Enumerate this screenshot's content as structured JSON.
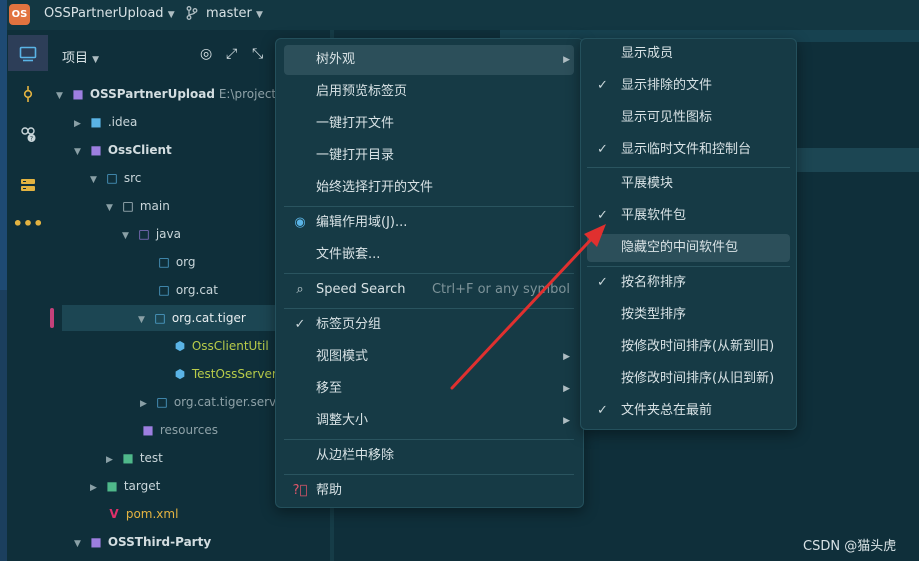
{
  "titlebar": {
    "logo_text": "OS",
    "project": "OSSPartnerUpload",
    "branch": "master"
  },
  "panel": {
    "title": "项目"
  },
  "tree": [
    {
      "label": "OSSPartnerUpload",
      "path": "E:\\project\\(",
      "icon": "module-folder-icon"
    },
    {
      "label": ".idea",
      "icon": "folder-icon"
    },
    {
      "label": "OssClient",
      "icon": "module-folder-icon"
    },
    {
      "label": "src",
      "icon": "source-folder-icon"
    },
    {
      "label": "main",
      "icon": "folder-icon"
    },
    {
      "label": "java",
      "icon": "java-source-folder-icon"
    },
    {
      "label": "org",
      "icon": "package-icon"
    },
    {
      "label": "org.cat",
      "icon": "package-icon"
    },
    {
      "label": "org.cat.tiger",
      "icon": "package-icon"
    },
    {
      "label": "OssClientUtil",
      "icon": "class-icon"
    },
    {
      "label": "TestOssServerU",
      "icon": "class-icon"
    },
    {
      "label": "org.cat.tiger.servic",
      "icon": "package-icon"
    },
    {
      "label": "resources",
      "icon": "resources-folder-icon"
    },
    {
      "label": "test",
      "icon": "test-folder-icon"
    },
    {
      "label": "target",
      "icon": "folder-icon"
    },
    {
      "label": "pom.xml",
      "icon": "maven-icon"
    },
    {
      "label": "OSSThird-Party",
      "icon": "module-folder-icon"
    }
  ],
  "menu": {
    "items": [
      {
        "label": "树外观",
        "submenu": true
      },
      {
        "label": "启用预览标签页"
      },
      {
        "label": "一键打开文件"
      },
      {
        "label": "一键打开目录"
      },
      {
        "label": "始终选择打开的文件"
      },
      {
        "label": "编辑作用域(J)...",
        "icon": "radio-icon"
      },
      {
        "label": "文件嵌套..."
      },
      {
        "label": "Speed Search",
        "icon": "search-icon",
        "shortcut": "Ctrl+F or any symbol"
      },
      {
        "label": "标签页分组",
        "icon": "check-icon"
      },
      {
        "label": "视图模式",
        "submenu": true
      },
      {
        "label": "移至",
        "submenu": true
      },
      {
        "label": "调整大小",
        "submenu": true
      },
      {
        "label": "从边栏中移除"
      },
      {
        "label": "帮助",
        "icon": "help-icon"
      }
    ]
  },
  "submenu": {
    "items": [
      {
        "label": "显示成员",
        "checked": false
      },
      {
        "label": "显示排除的文件",
        "checked": true
      },
      {
        "label": "显示可见性图标",
        "checked": false
      },
      {
        "label": "显示临时文件和控制台",
        "checked": true
      },
      {
        "label": "平展模块",
        "checked": false
      },
      {
        "label": "平展软件包",
        "checked": true
      },
      {
        "label": "隐藏空的中间软件包",
        "checked": false
      },
      {
        "label": "按名称排序",
        "checked": true
      },
      {
        "label": "按类型排序",
        "checked": false
      },
      {
        "label": "按修改时间排序(从新到旧)",
        "checked": false
      },
      {
        "label": "按修改时间排序(从旧到新)",
        "checked": false
      },
      {
        "label": "文件夹总在最前",
        "checked": true
      }
    ]
  },
  "watermark": "CSDN @猫头虎",
  "colors": {
    "background": "#0f2f3a",
    "menu_bg": "#163a45",
    "highlight": "#2c4f5a",
    "annotation_arrow": "#e0302f",
    "logo": "#e2733f"
  }
}
